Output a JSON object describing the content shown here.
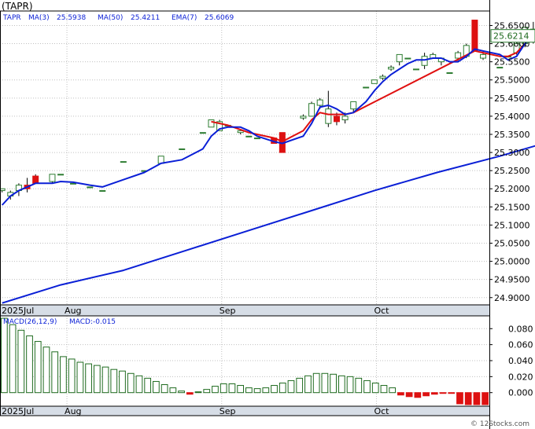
{
  "chart_data": [
    {
      "type": "candlestick",
      "title": "(TAPR)",
      "legend": {
        "ticker": "TAPR",
        "items": [
          {
            "label": "MA(3)",
            "value": "25.5938"
          },
          {
            "label": "MA(50)",
            "value": "25.4211"
          },
          {
            "label": "EMA(7)",
            "value": "25.6069"
          }
        ]
      },
      "y_ticks": [
        "25.6500",
        "25.6000",
        "25.5500",
        "25.5000",
        "25.4500",
        "25.4000",
        "25.3500",
        "25.3000",
        "25.2500",
        "25.2000",
        "25.1500",
        "25.1000",
        "25.0500",
        "25.0000",
        "24.9500",
        "24.9000"
      ],
      "ylim": [
        24.88,
        25.69
      ],
      "last_price_label": "25.6214",
      "x_labels": [
        "2025Jul",
        "Aug",
        "Sep",
        "Oct"
      ],
      "x_label_index": [
        0,
        16,
        53,
        90
      ],
      "n_bars": 117,
      "ohlc": [
        [
          46,
          25.195,
          25.2,
          25.19,
          25.2
        ],
        [
          48,
          25.18,
          25.195,
          25.17,
          25.19
        ],
        [
          50,
          25.195,
          25.215,
          25.18,
          25.21
        ],
        [
          52,
          25.21,
          25.23,
          25.19,
          25.2
        ],
        [
          54,
          25.235,
          25.24,
          25.215,
          25.215
        ],
        [
          58,
          25.22,
          25.24,
          25.215,
          25.24
        ],
        [
          60,
          25.24,
          25.24,
          25.24,
          25.24
        ],
        [
          63,
          25.215,
          25.215,
          25.215,
          25.215
        ],
        [
          67,
          25.205,
          25.205,
          25.205,
          25.205
        ],
        [
          70,
          25.195,
          25.195,
          25.195,
          25.195
        ],
        [
          75,
          25.275,
          25.275,
          25.275,
          25.275
        ],
        [
          80,
          25.25,
          25.25,
          25.25,
          25.25
        ],
        [
          84,
          25.27,
          25.29,
          25.27,
          25.29
        ],
        [
          89,
          25.31,
          25.31,
          25.31,
          25.31
        ],
        [
          94,
          25.355,
          25.355,
          25.355,
          25.355
        ],
        [
          96,
          25.37,
          25.39,
          25.37,
          25.39
        ],
        [
          98,
          25.36,
          25.39,
          25.36,
          25.385
        ],
        [
          100,
          25.375,
          25.375,
          25.375,
          25.375
        ],
        [
          103,
          25.355,
          25.36,
          25.35,
          25.36
        ],
        [
          105,
          25.345,
          25.345,
          25.345,
          25.345
        ],
        [
          107,
          25.34,
          25.34,
          25.34,
          25.34
        ],
        [
          111,
          25.34,
          25.34,
          25.325,
          25.325
        ],
        [
          113,
          25.355,
          25.355,
          25.3,
          25.3
        ],
        [
          118,
          25.395,
          25.405,
          25.39,
          25.4
        ],
        [
          120,
          25.4,
          25.44,
          25.4,
          25.435
        ],
        [
          122,
          25.43,
          25.45,
          25.42,
          25.445
        ],
        [
          124,
          25.38,
          25.47,
          25.37,
          25.42
        ],
        [
          126,
          25.4,
          25.41,
          25.375,
          25.385
        ],
        [
          128,
          25.39,
          25.41,
          25.38,
          25.4
        ],
        [
          130,
          25.42,
          25.44,
          25.41,
          25.44
        ],
        [
          133,
          25.48,
          25.48,
          25.48,
          25.48
        ],
        [
          135,
          25.49,
          25.5,
          25.49,
          25.5
        ],
        [
          137,
          25.505,
          25.515,
          25.5,
          25.51
        ],
        [
          139,
          25.53,
          25.54,
          25.525,
          25.535
        ],
        [
          141,
          25.55,
          25.57,
          25.54,
          25.57
        ],
        [
          143,
          25.56,
          25.56,
          25.56,
          25.56
        ],
        [
          145,
          25.53,
          25.53,
          25.53,
          25.53
        ],
        [
          147,
          25.54,
          25.575,
          25.53,
          25.565
        ],
        [
          149,
          25.56,
          25.575,
          25.56,
          25.57
        ],
        [
          151,
          25.55,
          25.56,
          25.54,
          25.56
        ],
        [
          153,
          25.52,
          25.52,
          25.52,
          25.52
        ],
        [
          155,
          25.56,
          25.58,
          25.55,
          25.575
        ],
        [
          157,
          25.565,
          25.6,
          25.56,
          25.595
        ],
        [
          159,
          25.665,
          25.665,
          25.58,
          25.58
        ],
        [
          161,
          25.56,
          25.58,
          25.555,
          25.57
        ],
        [
          165,
          25.535,
          25.535,
          25.535,
          25.535
        ],
        [
          167,
          25.565,
          25.565,
          25.565,
          25.565
        ],
        [
          169,
          25.575,
          25.605,
          25.57,
          25.6
        ],
        [
          171,
          25.6,
          25.645,
          25.59,
          25.645
        ],
        [
          173,
          25.61,
          25.66,
          25.6,
          25.64
        ],
        [
          175,
          25.63,
          25.66,
          25.62,
          25.655
        ],
        [
          177,
          25.65,
          25.65,
          25.64,
          25.645
        ],
        [
          179,
          25.665,
          25.665,
          25.64,
          25.64
        ],
        [
          181,
          25.6,
          25.6,
          25.545,
          25.6
        ],
        [
          183,
          25.61,
          25.61,
          25.61,
          25.61
        ],
        [
          185,
          25.6,
          25.625,
          25.6,
          25.621
        ]
      ],
      "ma3": [
        [
          46,
          25.155
        ],
        [
          48,
          25.18
        ],
        [
          50,
          25.195
        ],
        [
          52,
          25.205
        ],
        [
          54,
          25.215
        ],
        [
          58,
          25.215
        ],
        [
          60,
          25.22
        ],
        [
          63,
          25.218
        ],
        [
          67,
          25.21
        ],
        [
          70,
          25.205
        ],
        [
          75,
          25.225
        ],
        [
          80,
          25.245
        ],
        [
          84,
          25.27
        ],
        [
          89,
          25.28
        ],
        [
          94,
          25.31
        ],
        [
          96,
          25.345
        ],
        [
          98,
          25.365
        ],
        [
          100,
          25.37
        ],
        [
          103,
          25.37
        ],
        [
          105,
          25.36
        ],
        [
          107,
          25.345
        ],
        [
          111,
          25.33
        ],
        [
          113,
          25.325
        ],
        [
          118,
          25.345
        ],
        [
          120,
          25.38
        ],
        [
          122,
          25.425
        ],
        [
          124,
          25.43
        ],
        [
          126,
          25.42
        ],
        [
          128,
          25.405
        ],
        [
          130,
          25.41
        ],
        [
          133,
          25.44
        ],
        [
          135,
          25.47
        ],
        [
          137,
          25.495
        ],
        [
          139,
          25.515
        ],
        [
          141,
          25.53
        ],
        [
          143,
          25.545
        ],
        [
          145,
          25.555
        ],
        [
          147,
          25.555
        ],
        [
          149,
          25.56
        ],
        [
          151,
          25.56
        ],
        [
          153,
          25.55
        ],
        [
          155,
          25.55
        ],
        [
          157,
          25.565
        ],
        [
          159,
          25.585
        ],
        [
          161,
          25.58
        ],
        [
          165,
          25.57
        ],
        [
          167,
          25.555
        ],
        [
          169,
          25.565
        ],
        [
          171,
          25.6
        ],
        [
          173,
          25.62
        ],
        [
          175,
          25.645
        ],
        [
          177,
          25.645
        ],
        [
          179,
          25.64
        ],
        [
          181,
          25.615
        ],
        [
          183,
          25.61
        ],
        [
          185,
          25.594
        ]
      ],
      "ema7": [
        [
          113,
          25.33
        ],
        [
          118,
          25.36
        ],
        [
          120,
          25.39
        ],
        [
          122,
          25.41
        ],
        [
          124,
          25.405
        ],
        [
          126,
          25.405
        ],
        [
          128,
          25.405
        ],
        [
          130,
          25.41
        ],
        [
          159,
          25.58
        ],
        [
          161,
          25.575
        ],
        [
          165,
          25.565
        ],
        [
          167,
          25.565
        ],
        [
          169,
          25.575
        ],
        [
          171,
          25.6
        ],
        [
          173,
          25.62
        ],
        [
          175,
          25.635
        ],
        [
          177,
          25.64
        ],
        [
          179,
          25.63
        ],
        [
          181,
          25.61
        ],
        [
          183,
          25.61
        ],
        [
          185,
          25.607
        ]
      ],
      "ema7_early": [
        [
          96,
          25.385
        ],
        [
          100,
          25.375
        ],
        [
          105,
          25.355
        ],
        [
          107,
          25.35
        ],
        [
          111,
          25.34
        ],
        [
          113,
          25.33
        ]
      ],
      "ma50": [
        [
          46,
          24.885
        ],
        [
          60,
          24.935
        ],
        [
          75,
          24.975
        ],
        [
          90,
          25.03
        ],
        [
          105,
          25.085
        ],
        [
          120,
          25.14
        ],
        [
          135,
          25.195
        ],
        [
          150,
          25.245
        ],
        [
          165,
          25.29
        ],
        [
          180,
          25.34
        ],
        [
          195,
          25.395
        ],
        [
          205,
          25.421
        ]
      ],
      "macd": {
        "label": "MACD(26,12,9)",
        "value_label": "MACD:-0.015",
        "y_ticks": [
          "0.080",
          "0.060",
          "0.040",
          "0.020",
          "0.000"
        ],
        "ylim": [
          -0.017,
          0.096
        ],
        "hist": [
          0.093,
          0.085,
          0.078,
          0.071,
          0.064,
          0.057,
          0.051,
          0.045,
          0.042,
          0.038,
          0.036,
          0.034,
          0.032,
          0.029,
          0.027,
          0.024,
          0.021,
          0.018,
          0.014,
          0.01,
          0.006,
          0.002,
          -0.002,
          0.001,
          0.004,
          0.008,
          0.011,
          0.011,
          0.009,
          0.006,
          0.005,
          0.006,
          0.009,
          0.012,
          0.015,
          0.018,
          0.021,
          0.024,
          0.024,
          0.023,
          0.021,
          0.02,
          0.018,
          0.015,
          0.012,
          0.009,
          0.006,
          -0.003,
          -0.005,
          -0.006,
          -0.004,
          -0.002,
          -0.001,
          -0.001,
          -0.014,
          -0.015,
          -0.015,
          -0.015
        ]
      }
    }
  ],
  "watermark": "© 12Stocks.com"
}
